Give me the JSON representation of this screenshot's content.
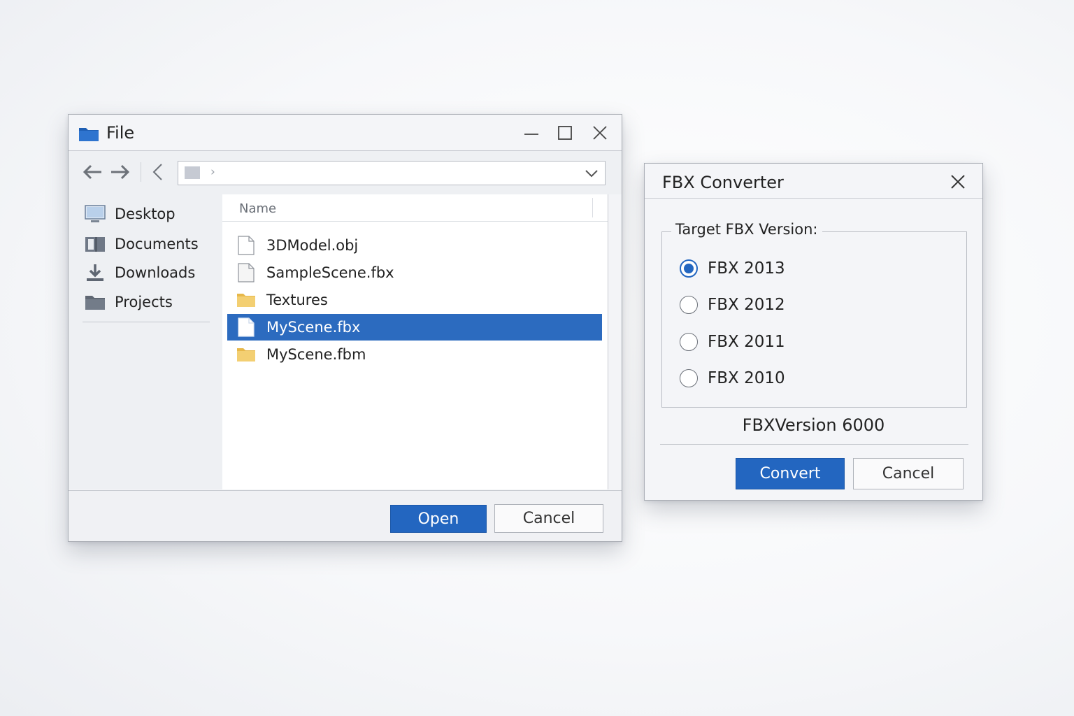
{
  "file_dialog": {
    "title": "File",
    "address": {
      "value": ""
    },
    "sidebar": {
      "items": [
        {
          "label": "Desktop",
          "icon": "desktop-icon"
        },
        {
          "label": "Documents",
          "icon": "documents-icon"
        },
        {
          "label": "Downloads",
          "icon": "downloads-icon"
        },
        {
          "label": "Projects",
          "icon": "projects-folder-icon"
        }
      ]
    },
    "columns": {
      "name": "Name"
    },
    "files": [
      {
        "name": "3DModel.obj",
        "type": "file",
        "selected": false
      },
      {
        "name": "SampleScene.fbx",
        "type": "file",
        "selected": false
      },
      {
        "name": "Textures",
        "type": "folder",
        "selected": false
      },
      {
        "name": "MyScene.fbx",
        "type": "file",
        "selected": true
      },
      {
        "name": "MyScene.fbm",
        "type": "folder",
        "selected": false
      }
    ],
    "buttons": {
      "open": "Open",
      "cancel": "Cancel"
    }
  },
  "fbx_converter": {
    "title": "FBX Converter",
    "group_label": "Target FBX Version:",
    "options": [
      {
        "label": "FBX 2013",
        "checked": true
      },
      {
        "label": "FBX 2012",
        "checked": false
      },
      {
        "label": "FBX 2011",
        "checked": false
      },
      {
        "label": "FBX 2010",
        "checked": false
      }
    ],
    "version_text": "FBXVersion 6000",
    "buttons": {
      "convert": "Convert",
      "cancel": "Cancel"
    }
  },
  "colors": {
    "accent": "#2366c0",
    "selection": "#2c6bbf",
    "folder": "#f0c75e"
  }
}
